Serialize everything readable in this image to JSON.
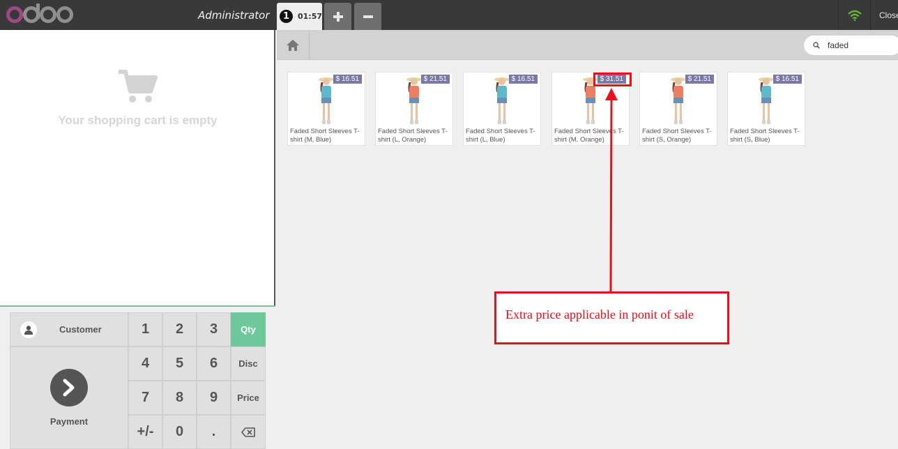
{
  "app": {
    "logo_text": "odoo",
    "user": "Administrator",
    "order_number": "1",
    "order_time": "01:57",
    "close_label": "Close"
  },
  "cart": {
    "empty_message": "Your shopping cart is empty"
  },
  "numpad": {
    "customer_label": "Customer",
    "payment_label": "Payment",
    "keys": [
      "1",
      "2",
      "3",
      "4",
      "5",
      "6",
      "7",
      "8",
      "9",
      "+/-",
      "0",
      "."
    ],
    "modes": [
      "Qty",
      "Disc",
      "Price"
    ],
    "active_mode": "Qty"
  },
  "search": {
    "value": "faded"
  },
  "products": [
    {
      "name": "Faded Short Sleeves T-shirt (M, Blue)",
      "price": "$ 16.51",
      "shirt_color": "#5fb9c9"
    },
    {
      "name": "Faded Short Sleeves T-shirt (L, Orange)",
      "price": "$ 21.51",
      "shirt_color": "#ec7f63"
    },
    {
      "name": "Faded Short Sleeves T-shirt (L, Blue)",
      "price": "$ 16.51",
      "shirt_color": "#5fb9c9"
    },
    {
      "name": "Faded Short Sleeves T-shirt (M, Orange)",
      "price": "$ 31.51",
      "shirt_color": "#ec7f63"
    },
    {
      "name": "Faded Short Sleeves T-shirt (S, Orange)",
      "price": "$ 21.51",
      "shirt_color": "#ec7f63"
    },
    {
      "name": "Faded Short Sleeves T-shirt (S, Blue)",
      "price": "$ 16.51",
      "shirt_color": "#5fb9c9"
    }
  ],
  "annotation": {
    "text": "Extra price applicable in ponit of sale"
  },
  "colors": {
    "topbar": "#393939",
    "accent": "#6ec89b",
    "price_badge": "#7a78a7",
    "annotation": "#e8101a"
  }
}
